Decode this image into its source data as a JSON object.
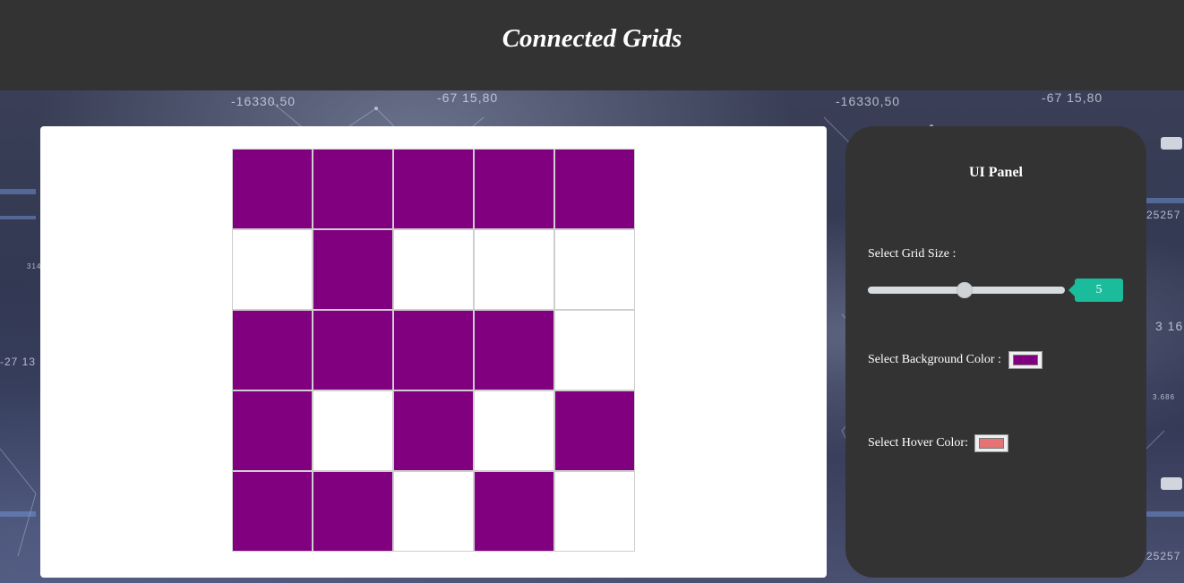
{
  "header": {
    "title": "Connected Grids"
  },
  "background": {
    "numbers": [
      "-16330,50",
      "-67 15,80",
      "-16330,50",
      "-67 15,80",
      "25257",
      "3 16",
      "-27 13",
      "25257",
      "314",
      "3.686"
    ]
  },
  "grid": {
    "size": 5,
    "cells": [
      [
        1,
        1,
        1,
        1,
        1
      ],
      [
        0,
        1,
        0,
        0,
        0
      ],
      [
        1,
        1,
        1,
        1,
        0
      ],
      [
        1,
        0,
        1,
        0,
        1
      ],
      [
        1,
        1,
        0,
        1,
        0
      ]
    ],
    "fill_color": "#800080",
    "empty_color": "#ffffff"
  },
  "panel": {
    "title": "UI Panel",
    "grid_size_label": "Select Grid Size :",
    "grid_size_value": "5",
    "slider_fraction": 0.4,
    "background_color_label": "Select Background Color :",
    "background_color_value": "#800080",
    "hover_color_label": "Select Hover Color:",
    "hover_color_value": "#e57373"
  },
  "colors": {
    "header_bg": "#333333",
    "panel_bg": "#333333",
    "accent": "#1abc9c"
  }
}
